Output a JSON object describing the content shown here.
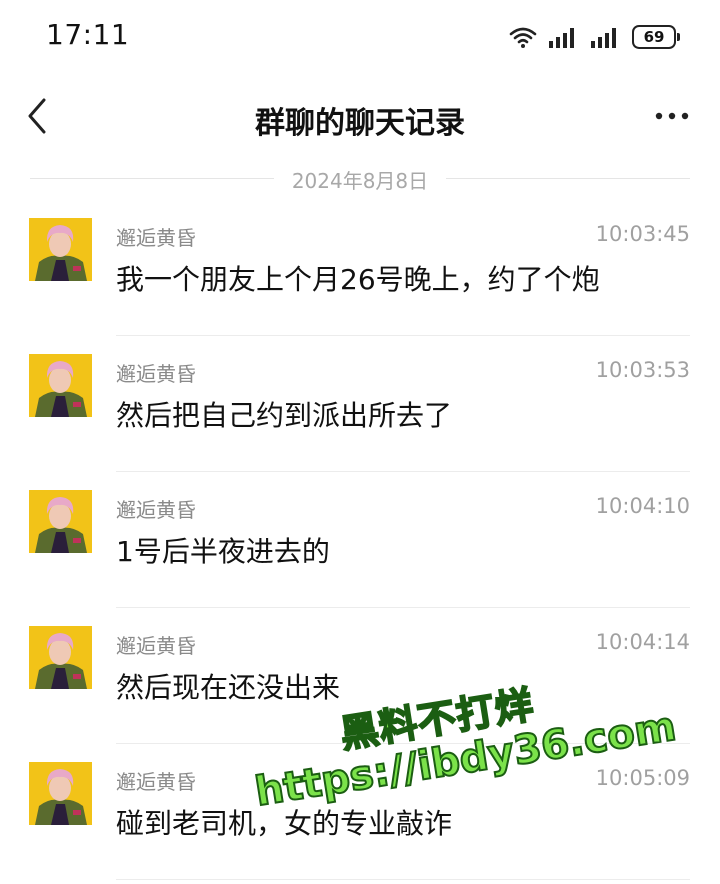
{
  "status_bar": {
    "time": "17:11",
    "battery": "69",
    "icons": [
      "wifi-icon",
      "signal-icon",
      "signal-icon",
      "battery-icon"
    ]
  },
  "header": {
    "title": "群聊的聊天记录",
    "back_icon": "chevron-left-icon",
    "more_icon": "more-horizontal-icon"
  },
  "date_divider": "2024年8月8日",
  "messages": [
    {
      "sender": "邂逅黄昏",
      "time": "10:03:45",
      "text": "我一个朋友上个月26号晚上，约了个炮"
    },
    {
      "sender": "邂逅黄昏",
      "time": "10:03:53",
      "text": "然后把自己约到派出所去了"
    },
    {
      "sender": "邂逅黄昏",
      "time": "10:04:10",
      "text": "1号后半夜进去的"
    },
    {
      "sender": "邂逅黄昏",
      "time": "10:04:14",
      "text": "然后现在还没出来"
    },
    {
      "sender": "邂逅黄昏",
      "time": "10:05:09",
      "text": "碰到老司机，女的专业敲诈"
    }
  ],
  "watermark": {
    "line1": "黑料不打烊",
    "line2": "https://ibdy36.com"
  },
  "colors": {
    "avatar_bg": "#f2c318",
    "watermark_fill": "#7be24a",
    "watermark_stroke": "#1b5e12"
  }
}
